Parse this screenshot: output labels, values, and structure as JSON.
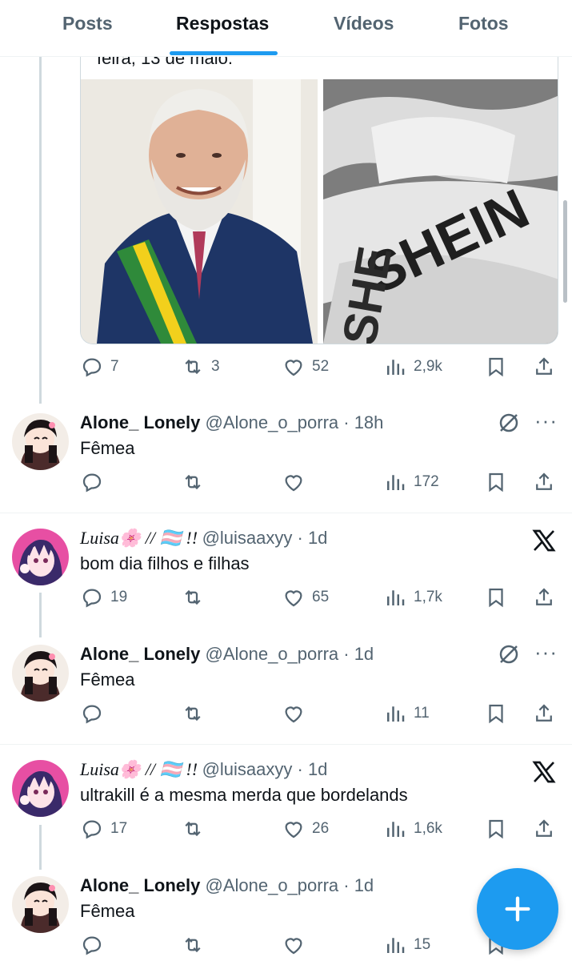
{
  "tabs": [
    {
      "label": "Posts"
    },
    {
      "label": "Respostas"
    },
    {
      "label": "Vídeos"
    },
    {
      "label": "Fotos"
    }
  ],
  "quoted": {
    "text": "feira, 13 de maio."
  },
  "tweets": [
    {
      "actions": {
        "replies": "7",
        "reposts": "3",
        "likes": "52",
        "views": "2,9k"
      }
    },
    {
      "name": "Alone_ Lonely",
      "handle": "@Alone_o_porra · 18h",
      "text": "Fêmea",
      "actions": {
        "replies": "",
        "reposts": "",
        "likes": "",
        "views": "172"
      }
    },
    {
      "name": "Luisa🌸 // 🏳️‍⚧️ !!",
      "handle": "@luisaaxyy · 1d",
      "text": "bom dia filhos e filhas",
      "actions": {
        "replies": "19",
        "reposts": "",
        "likes": "65",
        "views": "1,7k"
      }
    },
    {
      "name": "Alone_ Lonely",
      "handle": "@Alone_o_porra · 1d",
      "text": "Fêmea",
      "actions": {
        "replies": "",
        "reposts": "",
        "likes": "",
        "views": "11"
      }
    },
    {
      "name": "Luisa🌸 // 🏳️‍⚧️ !!",
      "handle": "@luisaaxyy · 1d",
      "text": "ultrakill é a mesma merda que bordelands",
      "actions": {
        "replies": "17",
        "reposts": "",
        "likes": "26",
        "views": "1,6k"
      }
    },
    {
      "name": "Alone_ Lonely",
      "handle": "@Alone_o_porra · 1d",
      "text": "Fêmea",
      "actions": {
        "replies": "",
        "reposts": "",
        "likes": "",
        "views": "15"
      }
    }
  ],
  "colors": {
    "accent": "#1d9bf0",
    "secondary_text": "#536471",
    "primary_text": "#0f1419"
  },
  "icons": [
    "reply-icon",
    "repost-icon",
    "like-icon",
    "views-icon",
    "bookmark-icon",
    "share-icon",
    "more-icon",
    "grok-icon",
    "x-logo-icon",
    "compose-plus-icon"
  ]
}
